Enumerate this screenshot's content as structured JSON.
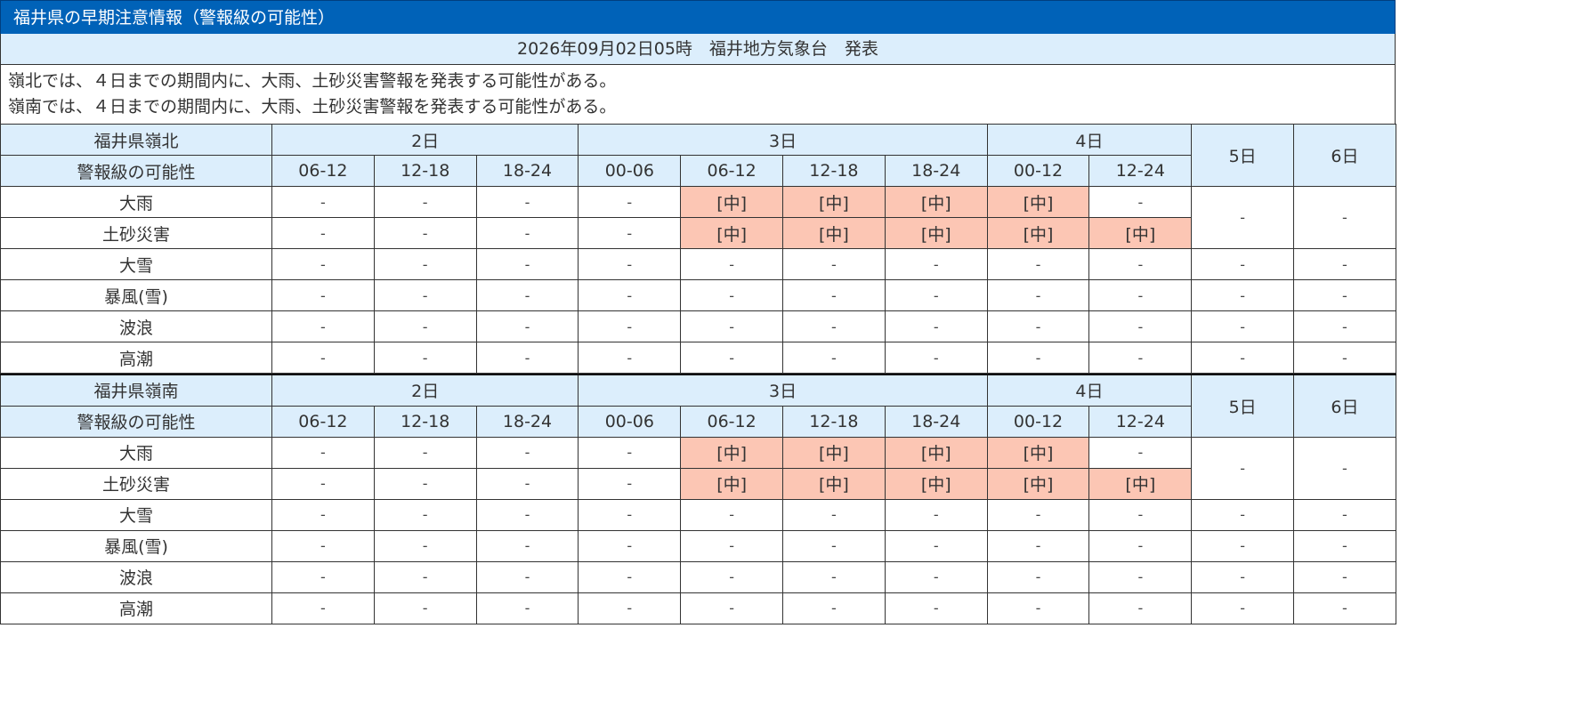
{
  "page": {
    "title": "福井県の早期注意情報（警報級の可能性）",
    "issued": "2026年09月02日05時　福井地方気象台　発表",
    "summary": [
      "嶺北では、４日までの期間内に、大雨、土砂災害警報を発表する可能性がある。",
      "嶺南では、４日までの期間内に、大雨、土砂災害警報を発表する可能性がある。"
    ]
  },
  "colors": {
    "header_bg": "#0062b8",
    "header_cell_bg": "#dceefc",
    "highlight_bg": "#fcc6b4"
  },
  "regions": [
    {
      "name": "福井県嶺北",
      "row_label": "警報級の可能性",
      "days": [
        {
          "label": "2日",
          "slots": [
            "06-12",
            "12-18",
            "18-24"
          ]
        },
        {
          "label": "3日",
          "slots": [
            "00-06",
            "06-12",
            "12-18",
            "18-24"
          ]
        },
        {
          "label": "4日",
          "slots": [
            "00-12",
            "12-24"
          ]
        }
      ],
      "extra_days": [
        "5日",
        "6日"
      ],
      "rows": [
        {
          "name": "大雨",
          "values": [
            "-",
            "-",
            "-",
            "-",
            "[中]",
            "[中]",
            "[中]",
            "[中]",
            "-"
          ],
          "day5": "-",
          "day6": "-"
        },
        {
          "name": "土砂災害",
          "values": [
            "-",
            "-",
            "-",
            "-",
            "[中]",
            "[中]",
            "[中]",
            "[中]",
            "[中]"
          ]
        },
        {
          "name": "大雪",
          "values": [
            "-",
            "-",
            "-",
            "-",
            "-",
            "-",
            "-",
            "-",
            "-"
          ],
          "day5": "-",
          "day6": "-"
        },
        {
          "name": "暴風(雪)",
          "values": [
            "-",
            "-",
            "-",
            "-",
            "-",
            "-",
            "-",
            "-",
            "-"
          ],
          "day5": "-",
          "day6": "-"
        },
        {
          "name": "波浪",
          "values": [
            "-",
            "-",
            "-",
            "-",
            "-",
            "-",
            "-",
            "-",
            "-"
          ],
          "day5": "-",
          "day6": "-"
        },
        {
          "name": "高潮",
          "values": [
            "-",
            "-",
            "-",
            "-",
            "-",
            "-",
            "-",
            "-",
            "-"
          ],
          "day5": "-",
          "day6": "-"
        }
      ]
    },
    {
      "name": "福井県嶺南",
      "row_label": "警報級の可能性",
      "days": [
        {
          "label": "2日",
          "slots": [
            "06-12",
            "12-18",
            "18-24"
          ]
        },
        {
          "label": "3日",
          "slots": [
            "00-06",
            "06-12",
            "12-18",
            "18-24"
          ]
        },
        {
          "label": "4日",
          "slots": [
            "00-12",
            "12-24"
          ]
        }
      ],
      "extra_days": [
        "5日",
        "6日"
      ],
      "rows": [
        {
          "name": "大雨",
          "values": [
            "-",
            "-",
            "-",
            "-",
            "[中]",
            "[中]",
            "[中]",
            "[中]",
            "-"
          ],
          "day5": "-",
          "day6": "-"
        },
        {
          "name": "土砂災害",
          "values": [
            "-",
            "-",
            "-",
            "-",
            "[中]",
            "[中]",
            "[中]",
            "[中]",
            "[中]"
          ]
        },
        {
          "name": "大雪",
          "values": [
            "-",
            "-",
            "-",
            "-",
            "-",
            "-",
            "-",
            "-",
            "-"
          ],
          "day5": "-",
          "day6": "-"
        },
        {
          "name": "暴風(雪)",
          "values": [
            "-",
            "-",
            "-",
            "-",
            "-",
            "-",
            "-",
            "-",
            "-"
          ],
          "day5": "-",
          "day6": "-"
        },
        {
          "name": "波浪",
          "values": [
            "-",
            "-",
            "-",
            "-",
            "-",
            "-",
            "-",
            "-",
            "-"
          ],
          "day5": "-",
          "day6": "-"
        },
        {
          "name": "高潮",
          "values": [
            "-",
            "-",
            "-",
            "-",
            "-",
            "-",
            "-",
            "-",
            "-"
          ],
          "day5": "-",
          "day6": "-"
        }
      ]
    }
  ]
}
